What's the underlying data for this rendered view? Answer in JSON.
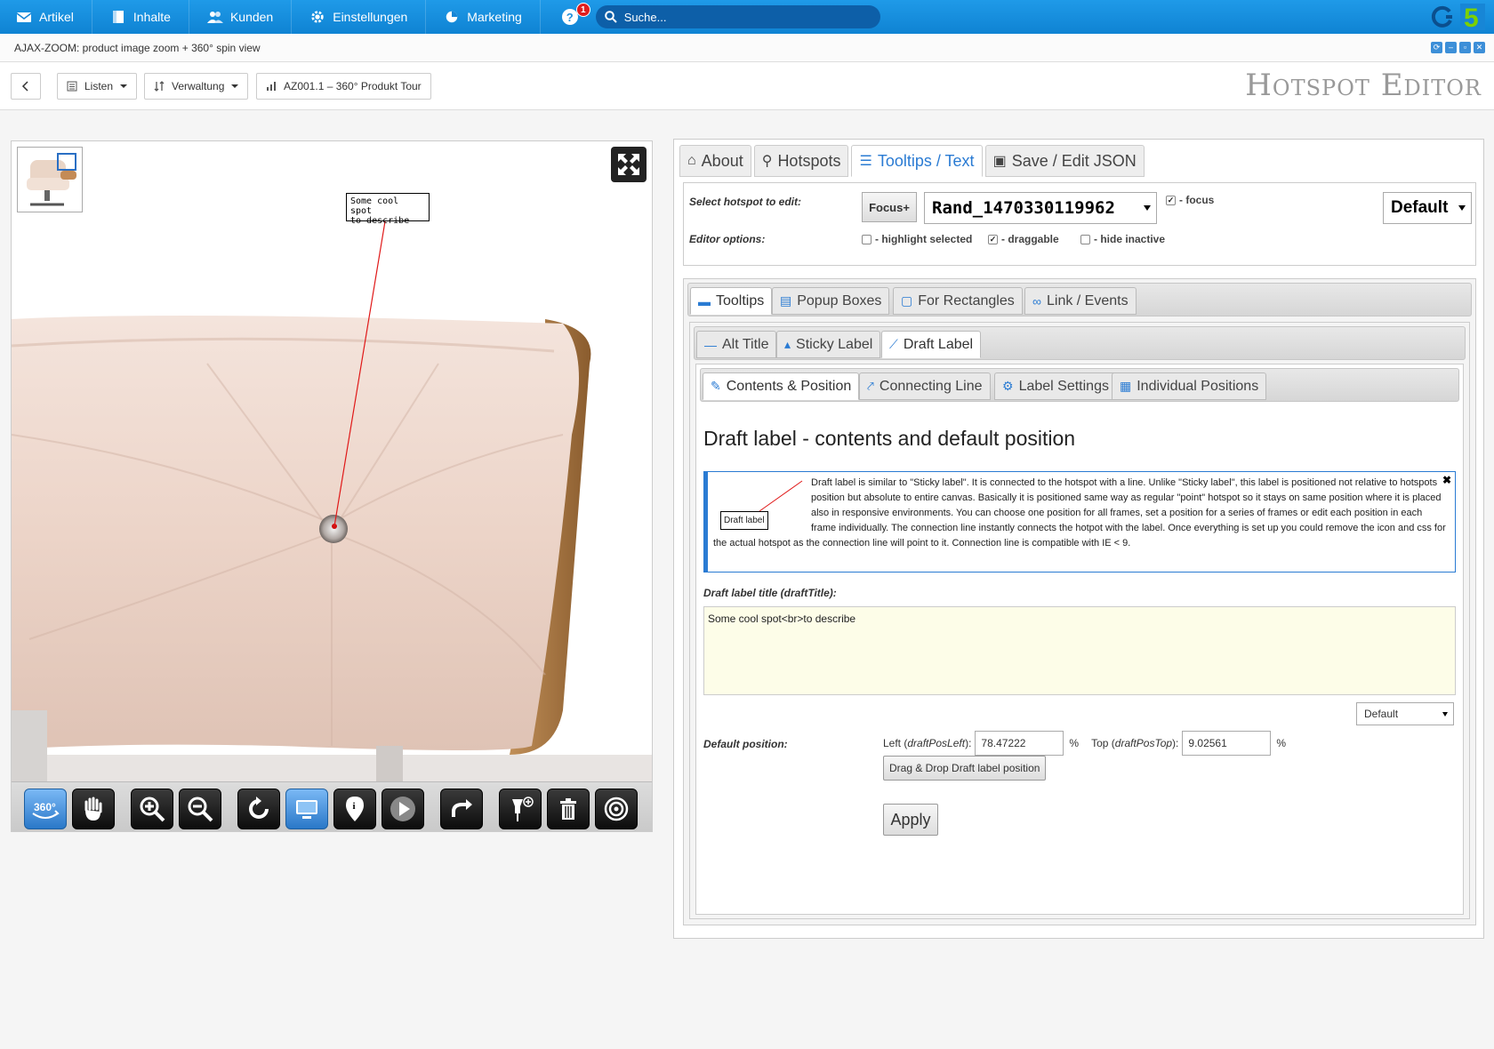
{
  "topnav": {
    "items": [
      {
        "label": "Artikel",
        "icon": "envelope-icon"
      },
      {
        "label": "Inhalte",
        "icon": "document-icon"
      },
      {
        "label": "Kunden",
        "icon": "users-icon"
      },
      {
        "label": "Einstellungen",
        "icon": "gear-icon"
      },
      {
        "label": "Marketing",
        "icon": "pie-chart-icon"
      }
    ],
    "help_badge": "1",
    "search_placeholder": "Suche..."
  },
  "window": {
    "title": "AJAX-ZOOM: product image zoom + 360° spin view"
  },
  "toolbar": {
    "lists_label": "Listen",
    "admin_label": "Verwaltung",
    "product_label": "AZ001.1 – 360° Produkt Tour",
    "editor_title": "Hotspot Editor"
  },
  "viewer": {
    "draft_label_line1": "Some cool spot",
    "draft_label_line2": "to describe"
  },
  "editor": {
    "main_tabs": [
      {
        "label": "About",
        "icon": "home-icon"
      },
      {
        "label": "Hotspots",
        "icon": "map-marker-icon"
      },
      {
        "label": "Tooltips / Text",
        "icon": "list-icon"
      },
      {
        "label": "Save / Edit JSON",
        "icon": "save-icon"
      }
    ],
    "select_hotspot_label": "Select hotspot to edit:",
    "focus_button": "Focus+",
    "hotspot_value": "Rand_1470330119962",
    "focus_checkbox": "- focus",
    "default_select": "Default",
    "editor_options_label": "Editor options:",
    "options": {
      "highlight": "- highlight selected",
      "draggable": "- draggable",
      "hide_inactive": "- hide inactive"
    },
    "sub_tabs": [
      {
        "label": "Tooltips",
        "icon": "comment-icon"
      },
      {
        "label": "Popup Boxes",
        "icon": "popup-icon"
      },
      {
        "label": "For Rectangles",
        "icon": "rectangle-icon"
      },
      {
        "label": "Link / Events",
        "icon": "link-icon"
      }
    ],
    "tooltip_tabs": [
      {
        "label": "Alt Title",
        "icon": "minus-icon"
      },
      {
        "label": "Sticky Label",
        "icon": "user-icon"
      },
      {
        "label": "Draft Label",
        "icon": "connector-icon"
      }
    ],
    "draft_tabs": [
      {
        "label": "Contents & Position",
        "icon": "pencil-icon"
      },
      {
        "label": "Connecting Line",
        "icon": "line-icon"
      },
      {
        "label": "Label Settings",
        "icon": "gear-icon"
      },
      {
        "label": "Individual Positions",
        "icon": "grid-icon"
      }
    ],
    "heading": "Draft label - contents and default position",
    "info_fig_label": "Draft label",
    "info_text": "Draft label is similar to \"Sticky label\". It is connected to the hotspot with a line. Unlike \"Sticky label\", this label is positioned not relative to hotspots position but absolute to entire canvas. Basically it is positioned same way as regular \"point\" hotspot so it stays on same position where it is placed also in responsive environments. You can choose one position for all frames, set a position for a series of frames or edit each position in each frame individually. The connection line instantly connects the hotpot with the label. Once everything is set up you could remove the icon and css for the actual hotspot as the connection line will point to it. Connection line is compatible with IE < 9.",
    "title_field_label": "Draft label title (draftTitle):",
    "title_value": "Some cool spot<br>to describe",
    "small_default": "Default",
    "default_position_label": "Default position:",
    "left_label_prefix": "Left (",
    "left_label_param": "draftPosLeft",
    "left_label_suffix": "):",
    "left_value": "78.47222",
    "top_label_prefix": "Top (",
    "top_label_param": "draftPosTop",
    "top_label_suffix": "):",
    "top_value": "9.02561",
    "percent": "%",
    "drag_button": "Drag & Drop Draft label position",
    "apply_button": "Apply"
  }
}
